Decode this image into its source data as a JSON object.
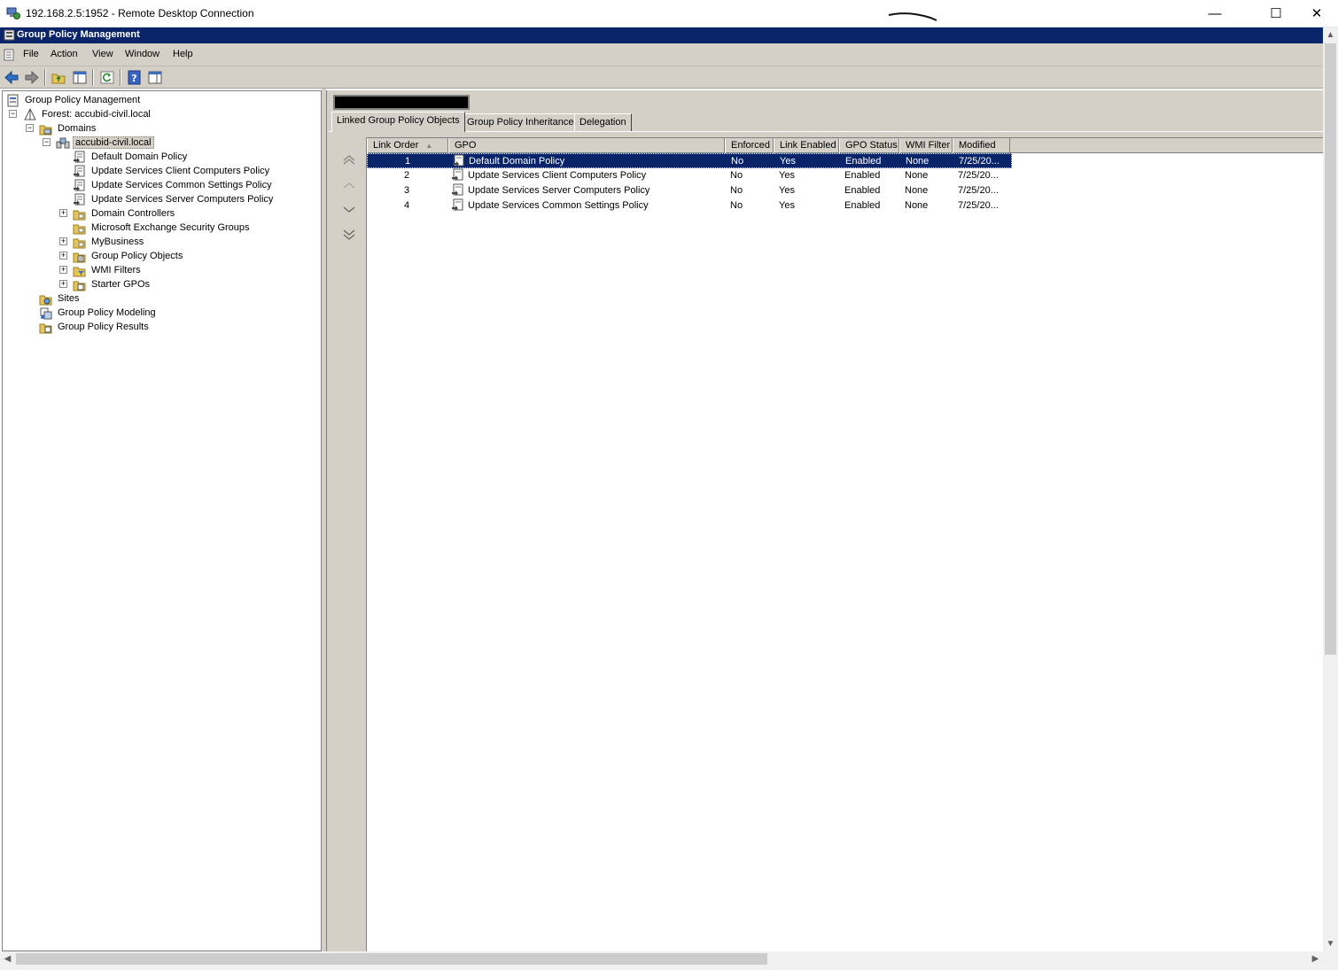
{
  "rdp": {
    "title": "192.168.2.5:1952 - Remote Desktop Connection",
    "minimize_glyph": "—",
    "maximize_glyph": "☐",
    "close_glyph": "✕"
  },
  "app": {
    "title": "Group Policy Management"
  },
  "menu": {
    "items": [
      "File",
      "Action",
      "View",
      "Window",
      "Help"
    ]
  },
  "toolbar": {
    "icons": [
      "back-arrow-icon",
      "forward-arrow-icon",
      "up-folder-icon",
      "show-tree-icon",
      "refresh-icon",
      "help-icon",
      "show-pane-icon"
    ]
  },
  "tree": {
    "root": "Group Policy Management",
    "forest": "Forest: accubid-civil.local",
    "domains": "Domains",
    "domain": "accubid-civil.local",
    "children": [
      "Default Domain Policy",
      "Update Services Client Computers Policy",
      "Update Services Common Settings Policy",
      "Update Services Server Computers Policy",
      "Domain Controllers",
      "Microsoft Exchange Security Groups",
      "MyBusiness",
      "Group Policy Objects",
      "WMI Filters",
      "Starter GPOs"
    ],
    "sites": "Sites",
    "modeling": "Group Policy Modeling",
    "results": "Group Policy Results"
  },
  "tabs": [
    "Linked Group Policy Objects",
    "Group Policy Inheritance",
    "Delegation"
  ],
  "columns": [
    "Link Order",
    "GPO",
    "Enforced",
    "Link Enabled",
    "GPO Status",
    "WMI Filter",
    "Modified"
  ],
  "rows": [
    {
      "order": "1",
      "gpo": "Default Domain Policy",
      "enforced": "No",
      "link_enabled": "Yes",
      "status": "Enabled",
      "wmi": "None",
      "modified": "7/25/20..."
    },
    {
      "order": "2",
      "gpo": "Update Services Client Computers Policy",
      "enforced": "No",
      "link_enabled": "Yes",
      "status": "Enabled",
      "wmi": "None",
      "modified": "7/25/20..."
    },
    {
      "order": "3",
      "gpo": "Update Services Server Computers Policy",
      "enforced": "No",
      "link_enabled": "Yes",
      "status": "Enabled",
      "wmi": "None",
      "modified": "7/25/20..."
    },
    {
      "order": "4",
      "gpo": "Update Services Common Settings Policy",
      "enforced": "No",
      "link_enabled": "Yes",
      "status": "Enabled",
      "wmi": "None",
      "modified": "7/25/20..."
    }
  ],
  "colors": {
    "selection": "#0a246a",
    "chrome": "#d4d0c8"
  }
}
